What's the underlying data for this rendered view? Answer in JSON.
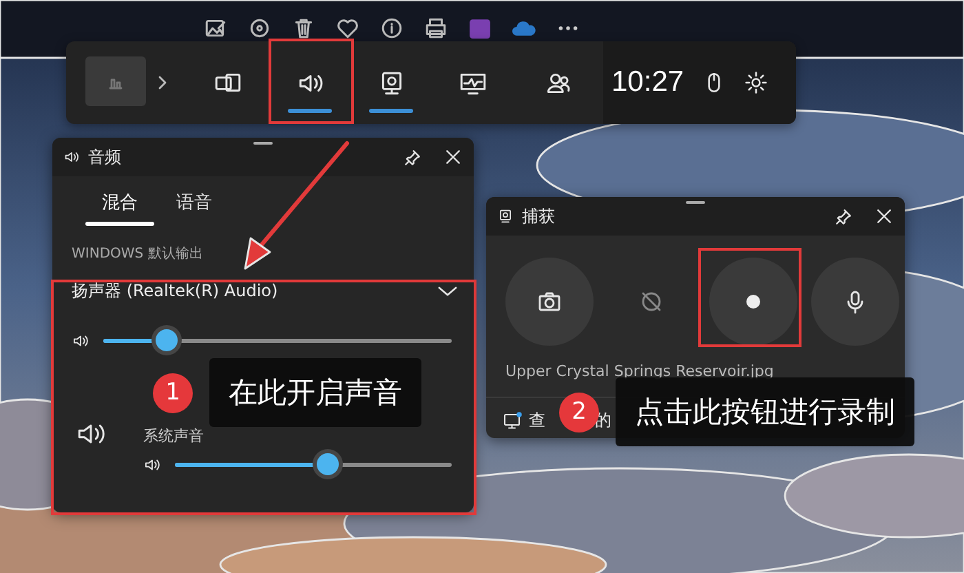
{
  "photo_toolbar": {
    "icons": [
      {
        "kind": "edit"
      },
      {
        "kind": "rotate"
      },
      {
        "kind": "delete"
      },
      {
        "kind": "favorite"
      },
      {
        "kind": "info"
      },
      {
        "kind": "print"
      },
      {
        "kind": "app-purple"
      },
      {
        "kind": "app-cloud"
      },
      {
        "kind": "more"
      }
    ]
  },
  "game_bar": {
    "widgets": [
      {
        "kind": "overlay",
        "on": false
      },
      {
        "kind": "audio",
        "on": true
      },
      {
        "kind": "capture",
        "on": true
      },
      {
        "kind": "performance",
        "on": false
      },
      {
        "kind": "social",
        "on": false
      }
    ],
    "time": "10:27"
  },
  "audio": {
    "title": "音频",
    "tabs": [
      {
        "label": "混合",
        "selected": true
      },
      {
        "label": "语音",
        "selected": false
      }
    ],
    "section_label": "WINDOWS 默认输出",
    "device": "扬声器 (Realtek(R) Audio)",
    "master": {
      "level": 0.18
    },
    "apps": [
      {
        "name": "系统声音",
        "level": 0.55
      }
    ]
  },
  "capture": {
    "title": "捕获",
    "buttons": [
      {
        "kind": "screenshot",
        "disabled": false
      },
      {
        "kind": "record-last",
        "disabled": true
      },
      {
        "kind": "record",
        "disabled": false
      },
      {
        "kind": "microphone",
        "disabled": false
      }
    ],
    "last_capture": "Upper Crystal Springs Reservoir.jpg",
    "footer_parts": [
      "查",
      "的"
    ]
  },
  "annotations": [
    {
      "number": "1",
      "text": "在此开启声音"
    },
    {
      "number": "2",
      "text": "点击此按钮进行录制"
    }
  ]
}
